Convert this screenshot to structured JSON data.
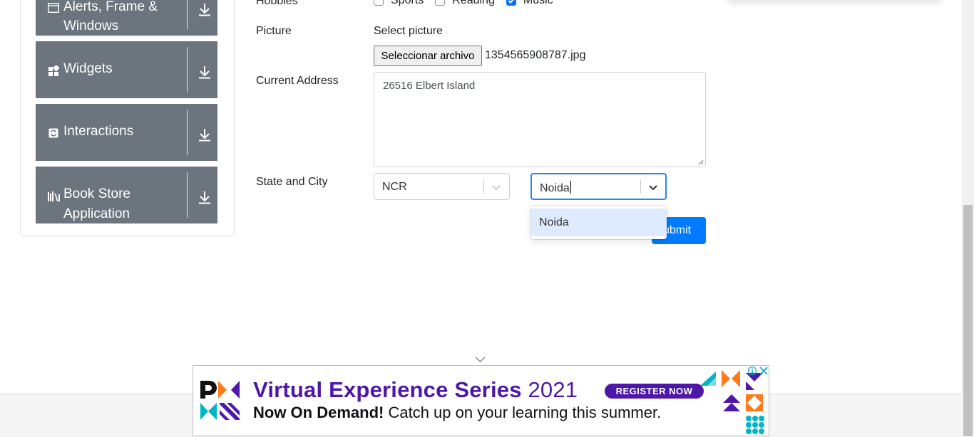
{
  "sidebar": {
    "groups": [
      {
        "label_line1": "Alerts, Frame &",
        "label_line2": "Windows",
        "icon": "window-icon",
        "action_icon": "download-arrow-icon"
      },
      {
        "label": "Widgets",
        "icon": "widgets-grid-icon",
        "action_icon": "download-arrow-icon"
      },
      {
        "label": "Interactions",
        "icon": "refresh-icon",
        "action_icon": "download-arrow-icon"
      },
      {
        "label_line1": "Book Store",
        "label_line2": "Application",
        "icon": "books-icon",
        "action_icon": "download-arrow-icon"
      }
    ]
  },
  "form": {
    "hobbies": {
      "label": "Hobbies",
      "options": [
        {
          "label": "Sports",
          "checked": false
        },
        {
          "label": "Reading",
          "checked": false
        },
        {
          "label": "Music",
          "checked": true
        }
      ]
    },
    "picture": {
      "label": "Picture",
      "select_label": "Select picture",
      "button_label": "Seleccionar archivo",
      "file_name": "1354565908787.jpg"
    },
    "address": {
      "label": "Current Address",
      "value": "26516 Elbert Island"
    },
    "state_city": {
      "label": "State and City",
      "state_value": "NCR",
      "city_value": "Noida",
      "dropdown_options": [
        "Noida"
      ]
    },
    "submit_label": "ubmit"
  },
  "ad": {
    "title_bold": "Virtual Experience Series",
    "title_year": "2021",
    "badge": "REGISTER NOW",
    "subtitle_bold": "Now On Demand!",
    "subtitle_rest": "Catch up on your learning this summer.",
    "colors": {
      "purple": "#4f17a8",
      "orange": "#ff7a1a",
      "teal": "#00b5c7",
      "blue": "#007bff"
    }
  }
}
